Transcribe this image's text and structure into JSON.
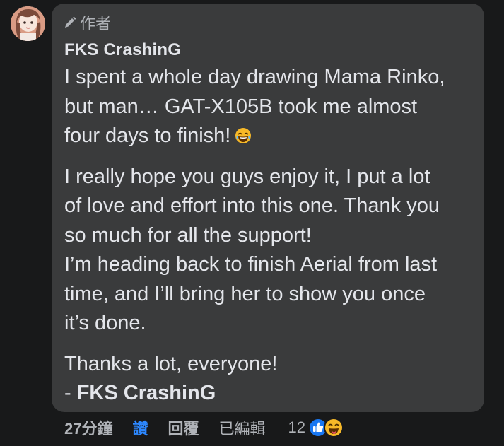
{
  "comment": {
    "author_badge": "作者",
    "author_name": "FKS CrashinG",
    "paragraphs": [
      [
        "I spent a whole day drawing Mama Rinko,",
        "but man… GAT-X105B took me almost",
        "four days to finish!"
      ],
      [
        "I really hope you guys enjoy it, I put a lot",
        "of love and effort into this one. Thank you",
        "so much for all the support!",
        "I’m heading back to finish Aerial from last",
        "time, and I’ll bring her to show you once",
        "it’s done."
      ],
      [
        "Thanks a lot, everyone!"
      ]
    ],
    "signature_prefix": "- ",
    "signature_name": "FKS CrashinG"
  },
  "footer": {
    "time": "27分鐘",
    "like_label": "讚",
    "reply_label": "回覆",
    "edited_label": "已編輯",
    "reaction_count": "12",
    "reactions": [
      "like-icon",
      "laughing-icon"
    ]
  },
  "colors": {
    "background": "#18191a",
    "bubble": "#3a3b3c",
    "text": "#e4e6eb",
    "secondary": "#b0b3b8",
    "accent": "#2d88ff"
  }
}
